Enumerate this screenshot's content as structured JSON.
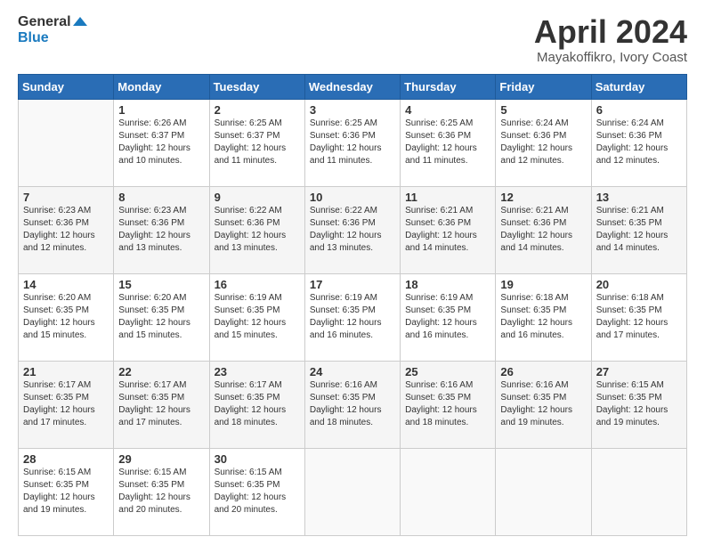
{
  "header": {
    "logo_line1": "General",
    "logo_line2": "Blue",
    "title": "April 2024",
    "subtitle": "Mayakoffikro, Ivory Coast"
  },
  "weekdays": [
    "Sunday",
    "Monday",
    "Tuesday",
    "Wednesday",
    "Thursday",
    "Friday",
    "Saturday"
  ],
  "weeks": [
    [
      {
        "day": "",
        "info": ""
      },
      {
        "day": "1",
        "info": "Sunrise: 6:26 AM\nSunset: 6:37 PM\nDaylight: 12 hours\nand 10 minutes."
      },
      {
        "day": "2",
        "info": "Sunrise: 6:25 AM\nSunset: 6:37 PM\nDaylight: 12 hours\nand 11 minutes."
      },
      {
        "day": "3",
        "info": "Sunrise: 6:25 AM\nSunset: 6:36 PM\nDaylight: 12 hours\nand 11 minutes."
      },
      {
        "day": "4",
        "info": "Sunrise: 6:25 AM\nSunset: 6:36 PM\nDaylight: 12 hours\nand 11 minutes."
      },
      {
        "day": "5",
        "info": "Sunrise: 6:24 AM\nSunset: 6:36 PM\nDaylight: 12 hours\nand 12 minutes."
      },
      {
        "day": "6",
        "info": "Sunrise: 6:24 AM\nSunset: 6:36 PM\nDaylight: 12 hours\nand 12 minutes."
      }
    ],
    [
      {
        "day": "7",
        "info": "Sunrise: 6:23 AM\nSunset: 6:36 PM\nDaylight: 12 hours\nand 12 minutes."
      },
      {
        "day": "8",
        "info": "Sunrise: 6:23 AM\nSunset: 6:36 PM\nDaylight: 12 hours\nand 13 minutes."
      },
      {
        "day": "9",
        "info": "Sunrise: 6:22 AM\nSunset: 6:36 PM\nDaylight: 12 hours\nand 13 minutes."
      },
      {
        "day": "10",
        "info": "Sunrise: 6:22 AM\nSunset: 6:36 PM\nDaylight: 12 hours\nand 13 minutes."
      },
      {
        "day": "11",
        "info": "Sunrise: 6:21 AM\nSunset: 6:36 PM\nDaylight: 12 hours\nand 14 minutes."
      },
      {
        "day": "12",
        "info": "Sunrise: 6:21 AM\nSunset: 6:36 PM\nDaylight: 12 hours\nand 14 minutes."
      },
      {
        "day": "13",
        "info": "Sunrise: 6:21 AM\nSunset: 6:35 PM\nDaylight: 12 hours\nand 14 minutes."
      }
    ],
    [
      {
        "day": "14",
        "info": "Sunrise: 6:20 AM\nSunset: 6:35 PM\nDaylight: 12 hours\nand 15 minutes."
      },
      {
        "day": "15",
        "info": "Sunrise: 6:20 AM\nSunset: 6:35 PM\nDaylight: 12 hours\nand 15 minutes."
      },
      {
        "day": "16",
        "info": "Sunrise: 6:19 AM\nSunset: 6:35 PM\nDaylight: 12 hours\nand 15 minutes."
      },
      {
        "day": "17",
        "info": "Sunrise: 6:19 AM\nSunset: 6:35 PM\nDaylight: 12 hours\nand 16 minutes."
      },
      {
        "day": "18",
        "info": "Sunrise: 6:19 AM\nSunset: 6:35 PM\nDaylight: 12 hours\nand 16 minutes."
      },
      {
        "day": "19",
        "info": "Sunrise: 6:18 AM\nSunset: 6:35 PM\nDaylight: 12 hours\nand 16 minutes."
      },
      {
        "day": "20",
        "info": "Sunrise: 6:18 AM\nSunset: 6:35 PM\nDaylight: 12 hours\nand 17 minutes."
      }
    ],
    [
      {
        "day": "21",
        "info": "Sunrise: 6:17 AM\nSunset: 6:35 PM\nDaylight: 12 hours\nand 17 minutes."
      },
      {
        "day": "22",
        "info": "Sunrise: 6:17 AM\nSunset: 6:35 PM\nDaylight: 12 hours\nand 17 minutes."
      },
      {
        "day": "23",
        "info": "Sunrise: 6:17 AM\nSunset: 6:35 PM\nDaylight: 12 hours\nand 18 minutes."
      },
      {
        "day": "24",
        "info": "Sunrise: 6:16 AM\nSunset: 6:35 PM\nDaylight: 12 hours\nand 18 minutes."
      },
      {
        "day": "25",
        "info": "Sunrise: 6:16 AM\nSunset: 6:35 PM\nDaylight: 12 hours\nand 18 minutes."
      },
      {
        "day": "26",
        "info": "Sunrise: 6:16 AM\nSunset: 6:35 PM\nDaylight: 12 hours\nand 19 minutes."
      },
      {
        "day": "27",
        "info": "Sunrise: 6:15 AM\nSunset: 6:35 PM\nDaylight: 12 hours\nand 19 minutes."
      }
    ],
    [
      {
        "day": "28",
        "info": "Sunrise: 6:15 AM\nSunset: 6:35 PM\nDaylight: 12 hours\nand 19 minutes."
      },
      {
        "day": "29",
        "info": "Sunrise: 6:15 AM\nSunset: 6:35 PM\nDaylight: 12 hours\nand 20 minutes."
      },
      {
        "day": "30",
        "info": "Sunrise: 6:15 AM\nSunset: 6:35 PM\nDaylight: 12 hours\nand 20 minutes."
      },
      {
        "day": "",
        "info": ""
      },
      {
        "day": "",
        "info": ""
      },
      {
        "day": "",
        "info": ""
      },
      {
        "day": "",
        "info": ""
      }
    ]
  ]
}
